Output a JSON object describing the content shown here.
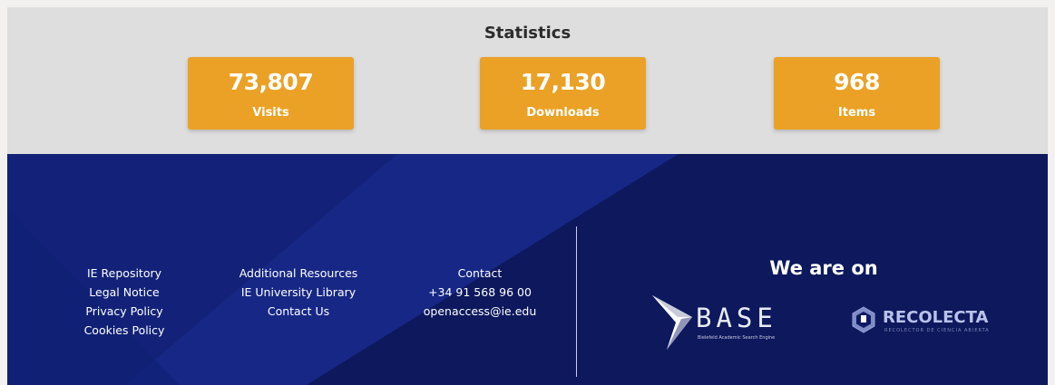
{
  "statistics": {
    "title": "Statistics",
    "cards": [
      {
        "value": "73,807",
        "label": "Visits"
      },
      {
        "value": "17,130",
        "label": "Downloads"
      },
      {
        "value": "968",
        "label": "Items"
      }
    ],
    "card_color": "#eba125"
  },
  "footer": {
    "background_color": "#0e1a63",
    "links_col1": [
      "IE Repository",
      "Legal Notice",
      "Privacy Policy",
      "Cookies Policy"
    ],
    "links_col2": [
      "Additional Resources",
      "IE University Library",
      "Contact Us"
    ],
    "contact": {
      "label": "Contact",
      "phone": "+34 91 568 96 00",
      "email": "openaccess@ie.edu"
    },
    "we_are_on": "We are on",
    "logos": {
      "base": {
        "name": "BASE",
        "tagline": "Bielefeld Academic Search Engine",
        "icon": "base-chevron-icon"
      },
      "recolecta": {
        "name": "RECOLECTA",
        "tagline": "RECOLECTOR DE CIENCIA ABIERTA",
        "icon": "recolecta-hexagon-icon"
      }
    }
  }
}
